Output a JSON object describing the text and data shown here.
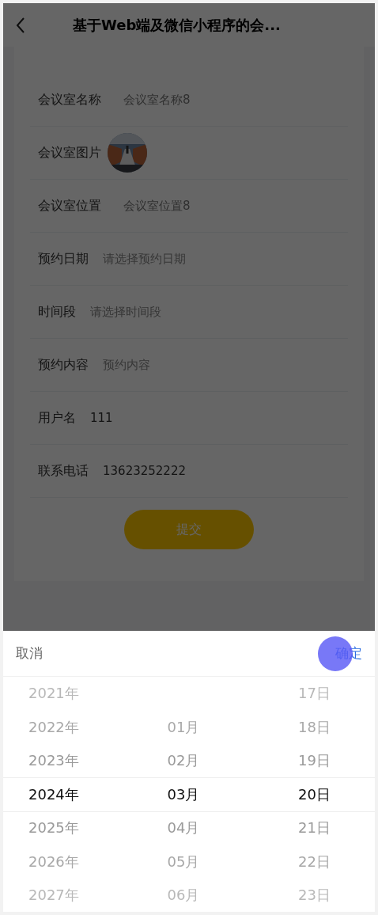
{
  "header": {
    "title": "基于Web端及微信小程序的会..."
  },
  "form": {
    "rows": [
      {
        "label": "会议室名称",
        "kind": "text",
        "value": "会议室名称8"
      },
      {
        "label": "会议室图片",
        "kind": "picture"
      },
      {
        "label": "会议室位置",
        "kind": "text",
        "value": "会议室位置8"
      },
      {
        "label": "预约日期",
        "kind": "input",
        "placeholder": "请选择预约日期"
      },
      {
        "label": "时间段",
        "kind": "input",
        "placeholder": "请选择时间段"
      },
      {
        "label": "预约内容",
        "kind": "input",
        "placeholder": "预约内容"
      },
      {
        "label": "用户名",
        "kind": "input",
        "value": "111"
      },
      {
        "label": "联系电话",
        "kind": "input",
        "value": "13623252222"
      }
    ],
    "submit": "提交"
  },
  "picker": {
    "cancel": "取消",
    "confirm": {
      "label": "确定",
      "pressed": true
    },
    "columns": [
      {
        "items": [
          {
            "label": "2021年",
            "selected": false
          },
          {
            "label": "2022年",
            "selected": false
          },
          {
            "label": "2023年",
            "selected": false
          },
          {
            "label": "2024年",
            "selected": true
          },
          {
            "label": "2025年",
            "selected": false
          },
          {
            "label": "2026年",
            "selected": false
          },
          {
            "label": "2027年",
            "selected": false
          }
        ]
      },
      {
        "items": [
          {
            "label": "01月",
            "selected": false
          },
          {
            "label": "02月",
            "selected": false
          },
          {
            "label": "03月",
            "selected": true
          },
          {
            "label": "04月",
            "selected": false
          },
          {
            "label": "05月",
            "selected": false
          },
          {
            "label": "06月",
            "selected": false
          }
        ]
      },
      {
        "items": [
          {
            "label": "17日",
            "selected": false
          },
          {
            "label": "18日",
            "selected": false
          },
          {
            "label": "19日",
            "selected": false
          },
          {
            "label": "20日",
            "selected": true
          },
          {
            "label": "21日",
            "selected": false
          },
          {
            "label": "22日",
            "selected": false
          },
          {
            "label": "23日",
            "selected": false
          }
        ]
      }
    ]
  }
}
